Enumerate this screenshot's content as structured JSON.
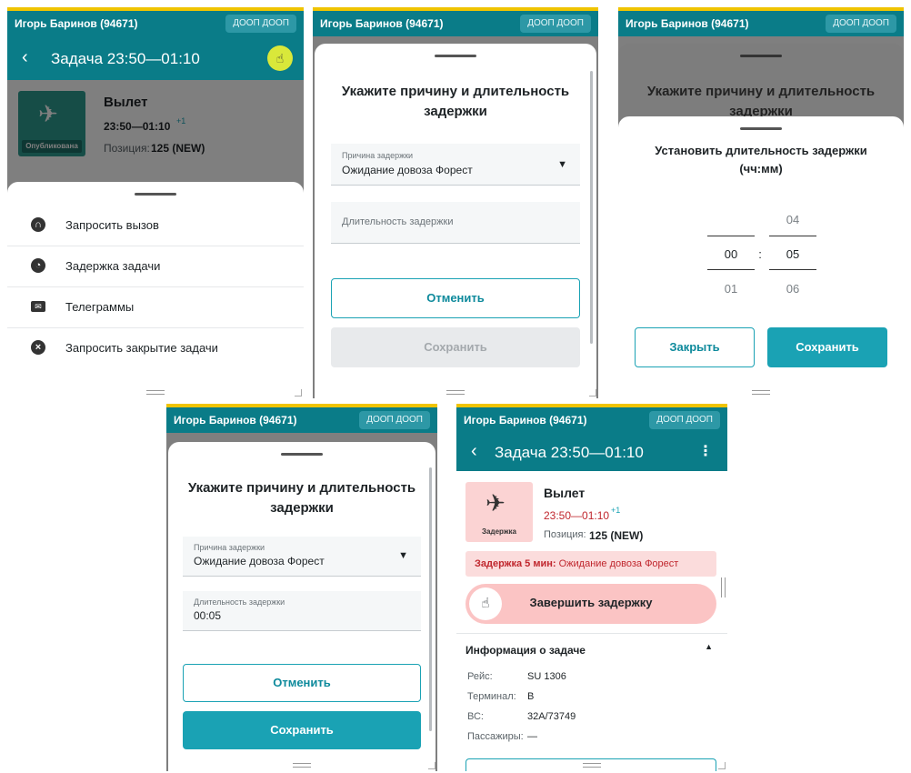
{
  "header": {
    "user": "Игорь Баринов (94671)",
    "badge": "ДООП ДООП"
  },
  "task": {
    "back": "‹",
    "title": "Задача 23:50—01:10",
    "kebab": "⋮",
    "type": "Вылет",
    "time": "23:50—01:10",
    "day_offset": "+1",
    "position_label": "Позиция:",
    "position_value": "125 (NEW)",
    "status_published": "Опубликована",
    "status_delayed": "Задержка"
  },
  "menu": [
    {
      "icon": "headset-icon",
      "label": "Запросить вызов"
    },
    {
      "icon": "clock-icon",
      "label": "Задержка задачи"
    },
    {
      "icon": "mail-icon",
      "label": "Телеграммы"
    },
    {
      "icon": "close-circle-icon",
      "label": "Запросить закрытие задачи"
    }
  ],
  "delay_dialog": {
    "title": "Укажите причину и длительность задержки",
    "reason_label": "Причина задержки",
    "reason_value": "Ожидание довоза Форест",
    "duration_placeholder": "Длительность задержки",
    "duration_label": "Длительность задержки",
    "duration_value": "00:05",
    "cancel": "Отменить",
    "save": "Сохранить"
  },
  "duration_picker": {
    "title": "Установить длительность задержки (чч:мм)",
    "hours_selected": "00",
    "hours_next": "01",
    "separator": ":",
    "minutes_prev": "04",
    "minutes_selected": "05",
    "minutes_next": "06",
    "close": "Закрыть",
    "save": "Сохранить"
  },
  "delay_banner": {
    "prefix": "Задержка 5 мин:",
    "reason": "Ожидание довоза Форест"
  },
  "finish_delay": {
    "label": "Завершить задержку"
  },
  "info": {
    "title": "Информация о задаче",
    "rows": [
      {
        "label": "Рейс:",
        "value": "SU 1306"
      },
      {
        "label": "Терминал:",
        "value": "B"
      },
      {
        "label": "ВС:",
        "value": "32A/73749"
      },
      {
        "label": "Пассажиры:",
        "value": "—"
      }
    ]
  },
  "colors": {
    "teal": "#0a7c88",
    "accent": "#1aa2b4",
    "gold": "#f0c400",
    "published_green": "#2c9a8f",
    "delay_pink": "#fbd3d3",
    "delay_red": "#c0262d"
  }
}
